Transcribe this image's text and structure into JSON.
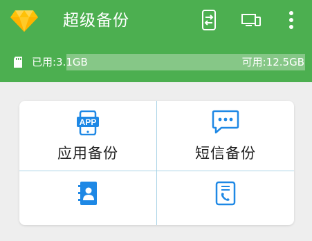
{
  "app": {
    "title": "超级备份",
    "logo_icon": "diamond-logo-icon",
    "accent_color": "#4caf50"
  },
  "toolbar": {
    "actions": [
      {
        "icon": "swap-icon"
      },
      {
        "icon": "devices-icon"
      },
      {
        "icon": "more-vert-icon"
      }
    ]
  },
  "storage": {
    "icon": "sd-card-icon",
    "used_label": "已用:3.1GB",
    "available_label": "可用:12.5GB",
    "used_fraction": 0.195
  },
  "grid": {
    "items": [
      {
        "label": "应用备份",
        "icon": "app-phone-icon",
        "badge": "APP"
      },
      {
        "label": "短信备份",
        "icon": "sms-bubble-icon"
      },
      {
        "label": "",
        "icon": "contacts-book-icon"
      },
      {
        "label": "",
        "icon": "call-log-icon"
      }
    ]
  }
}
